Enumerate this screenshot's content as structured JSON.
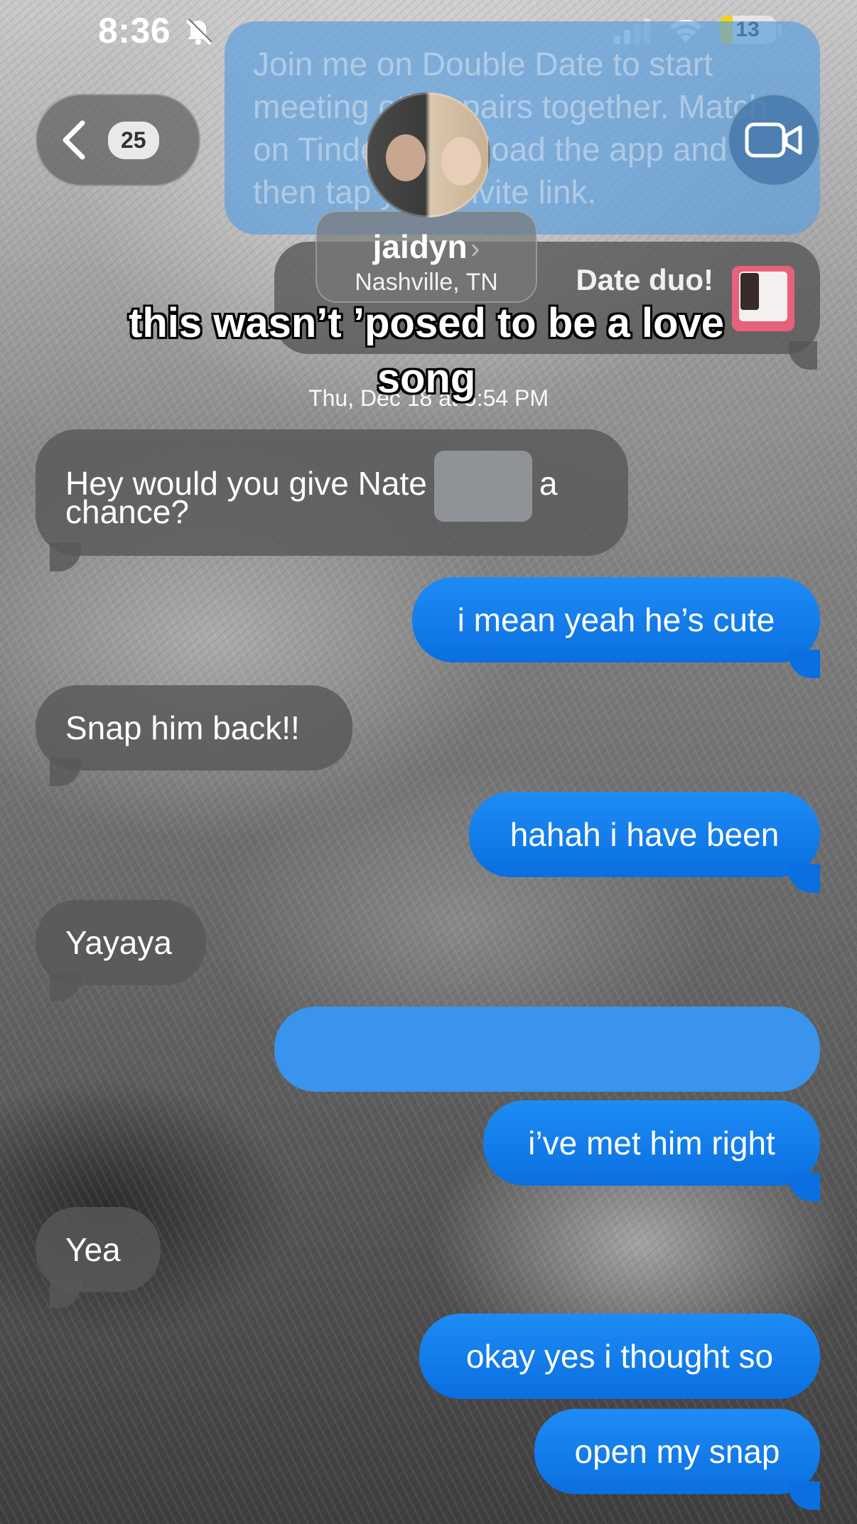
{
  "status_bar": {
    "time": "8:36",
    "battery": "13",
    "battery_level_percent": 13,
    "icons": [
      "bell-slash-icon",
      "cellular-signal-icon",
      "wifi-icon",
      "battery-icon"
    ]
  },
  "header": {
    "back_badge": "25",
    "contact_name": "jaidyn",
    "contact_chevron": "›",
    "contact_location": "Nashville, TN",
    "icons": [
      "chevron-left-icon",
      "video-camera-icon"
    ]
  },
  "background_messages": {
    "invite_text": "Join me on Double Date to start meeting other pairs together. Match on Tinder, download the app and then tap your invite link.",
    "duo_text": "Date duo!"
  },
  "overlay_caption": "this wasn’t ’posed to be a love song",
  "timestamp": "Thu, Dec 18 at 5:54 PM",
  "messages": [
    {
      "direction": "in",
      "text_before": "Hey would you give Nate",
      "text_after": "a",
      "text_line2": "chance?",
      "redacted": true
    },
    {
      "direction": "out",
      "text": "i mean yeah he’s cute"
    },
    {
      "direction": "in",
      "text": "Snap him back!!"
    },
    {
      "direction": "out",
      "text": "hahah i have been"
    },
    {
      "direction": "in",
      "text": "Yayaya"
    },
    {
      "direction": "out",
      "text": "",
      "redacted": true
    },
    {
      "direction": "out",
      "text": "i’ve met him right"
    },
    {
      "direction": "in",
      "text": "Yea"
    },
    {
      "direction": "out",
      "text": "okay yes i thought so"
    },
    {
      "direction": "out",
      "text": "open my snap"
    }
  ],
  "colors": {
    "outgoing_bubble": "#0a84ff",
    "incoming_bubble": "#585858",
    "battery_fill": "#f5d20c"
  }
}
